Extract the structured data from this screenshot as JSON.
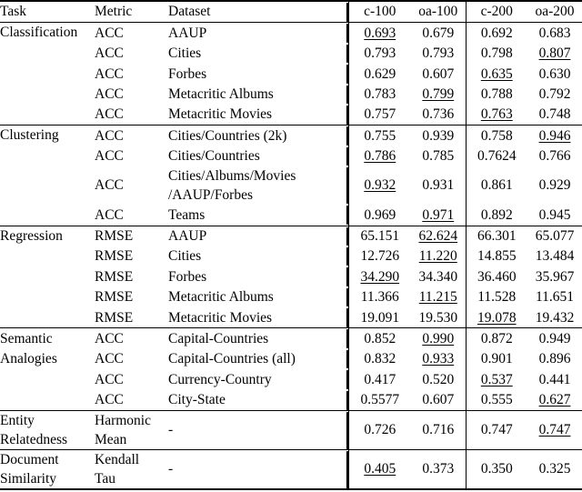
{
  "table": {
    "headers": {
      "task": "Task",
      "metric": "Metric",
      "dataset": "Dataset",
      "v1": "c-100",
      "v2": "oa-100",
      "v3": "c-200",
      "v4": "oa-200"
    },
    "sections": [
      {
        "task": "Classification",
        "rows": [
          {
            "metric": "ACC",
            "dataset": "AAUP",
            "values": [
              "0.693",
              "0.679",
              "0.692",
              "0.683"
            ],
            "styles": [
              "bu",
              "",
              "b",
              ""
            ]
          },
          {
            "metric": "ACC",
            "dataset": "Cities",
            "values": [
              "0.793",
              "0.793",
              "0.798",
              "0.807"
            ],
            "styles": [
              "b",
              "b",
              "",
              "bu"
            ]
          },
          {
            "metric": "ACC",
            "dataset": "Forbes",
            "values": [
              "0.629",
              "0.607",
              "0.635",
              "0.630"
            ],
            "styles": [
              "b",
              "",
              "bu",
              ""
            ]
          },
          {
            "metric": "ACC",
            "dataset": "Metacritic Albums",
            "values": [
              "0.783",
              "0.799",
              "0.788",
              "0.792"
            ],
            "styles": [
              "",
              "bu",
              "",
              "b"
            ]
          },
          {
            "metric": "ACC",
            "dataset": "Metacritic Movies",
            "values": [
              "0.757",
              "0.736",
              "0.763",
              "0.748"
            ],
            "styles": [
              "b",
              "",
              "bu",
              ""
            ]
          }
        ]
      },
      {
        "task": "Clustering",
        "rows": [
          {
            "metric": "ACC",
            "dataset": "Cities/Countries (2k)",
            "values": [
              "0.755",
              "0.939",
              "0.758",
              "0.946"
            ],
            "styles": [
              "",
              "b",
              "",
              "bu"
            ]
          },
          {
            "metric": "ACC",
            "dataset": "Cities/Countries",
            "values": [
              "0.786",
              "0.785",
              "0.7624",
              "0.766"
            ],
            "styles": [
              "bu",
              "",
              "",
              "b"
            ]
          },
          {
            "metric": "ACC",
            "dataset": "Cities/Albums/Movies\n/AAUP/Forbes",
            "dataset_line1": "Cities/Albums/Movies",
            "dataset_line2": "/AAUP/Forbes",
            "values": [
              "0.932",
              "0.931",
              "0.861",
              "0.929"
            ],
            "styles": [
              "bu",
              "",
              "",
              "b"
            ]
          },
          {
            "metric": "ACC",
            "dataset": "Teams",
            "values": [
              "0.969",
              "0.971",
              "0.892",
              "0.945"
            ],
            "styles": [
              "",
              "bu",
              "",
              "b"
            ]
          }
        ]
      },
      {
        "task": "Regression",
        "rows": [
          {
            "metric": "RMSE",
            "dataset": "AAUP",
            "values": [
              "65.151",
              "62.624",
              "66.301",
              "65.077"
            ],
            "styles": [
              "",
              "bu",
              "",
              "b"
            ]
          },
          {
            "metric": "RMSE",
            "dataset": "Cities",
            "values": [
              "12.726",
              "11.220",
              "14.855",
              "13.484"
            ],
            "styles": [
              "",
              "bu",
              "",
              "b"
            ]
          },
          {
            "metric": "RMSE",
            "dataset": "Forbes",
            "values": [
              "34.290",
              "34.340",
              "36.460",
              "35.967"
            ],
            "styles": [
              "bu",
              "",
              "",
              "b"
            ]
          },
          {
            "metric": "RMSE",
            "dataset": "Metacritic Albums",
            "values": [
              "11.366",
              "11.215",
              "11.528",
              "11.651"
            ],
            "styles": [
              "",
              "bu",
              "b",
              ""
            ]
          },
          {
            "metric": "RMSE",
            "dataset": "Metacritic Movies",
            "values": [
              "19.091",
              "19.530",
              "19.078",
              "19.432"
            ],
            "styles": [
              "b",
              "",
              "bu",
              ""
            ]
          }
        ]
      },
      {
        "task": "Semantic\nAnalogies",
        "task_line1": "Semantic",
        "task_line2": "Analogies",
        "rows": [
          {
            "metric": "ACC",
            "dataset": "Capital-Countries",
            "values": [
              "0.852",
              "0.990",
              "0.872",
              "0.949"
            ],
            "styles": [
              "",
              "bu",
              "",
              "b"
            ]
          },
          {
            "metric": "ACC",
            "dataset": "Capital-Countries (all)",
            "values": [
              "0.832",
              "0.933",
              "0.901",
              "0.896"
            ],
            "styles": [
              "",
              "bu",
              "b",
              ""
            ]
          },
          {
            "metric": "ACC",
            "dataset": "Currency-Country",
            "values": [
              "0.417",
              "0.520",
              "0.537",
              "0.441"
            ],
            "styles": [
              "",
              "b",
              "bu",
              ""
            ]
          },
          {
            "metric": "ACC",
            "dataset": "City-State",
            "values": [
              "0.5577",
              "0.607",
              "0.555",
              "0.627"
            ],
            "styles": [
              "",
              "b",
              "",
              "bu"
            ]
          }
        ]
      },
      {
        "task": "Entity\nRelatedness",
        "task_line1": "Entity",
        "task_line2": "Relatedness",
        "rows": [
          {
            "metric": "Harmonic\nMean",
            "metric_line1": "Harmonic",
            "metric_line2": "Mean",
            "dataset": "-",
            "values": [
              "0.726",
              "0.716",
              "0.747",
              "0.747"
            ],
            "styles": [
              "b",
              "",
              "b",
              "bu"
            ]
          }
        ]
      },
      {
        "task": "Document\nSimilarity",
        "task_line1": "Document",
        "task_line2": "Similarity",
        "rows": [
          {
            "metric": "Kendall\nTau",
            "metric_line1": "Kendall",
            "metric_line2": "Tau",
            "dataset": "-",
            "values": [
              "0.405",
              "0.373",
              "0.350",
              "0.325"
            ],
            "styles": [
              "bu",
              "",
              "b",
              ""
            ]
          }
        ]
      }
    ]
  }
}
